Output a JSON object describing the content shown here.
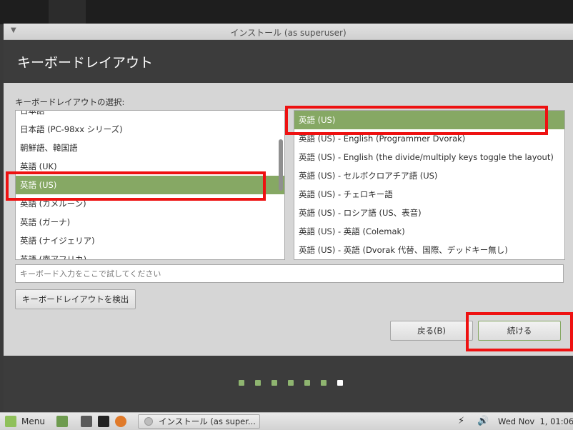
{
  "window": {
    "title": "インストール (as superuser)",
    "heading": "キーボードレイアウト"
  },
  "layout_section": {
    "label": "キーボードレイアウトの選択:",
    "left_list": [
      {
        "label": "日本語",
        "selected": false
      },
      {
        "label": "日本語 (PC-98xx シリーズ)",
        "selected": false
      },
      {
        "label": "朝鮮語、韓国語",
        "selected": false
      },
      {
        "label": "英語 (UK)",
        "selected": false
      },
      {
        "label": "英語 (US)",
        "selected": true
      },
      {
        "label": "英語 (カメルーン)",
        "selected": false
      },
      {
        "label": "英語 (ガーナ)",
        "selected": false
      },
      {
        "label": "英語 (ナイジェリア)",
        "selected": false
      },
      {
        "label": "英語 (南アフリカ)",
        "selected": false
      }
    ],
    "right_list": [
      {
        "label": "英語 (US)",
        "selected": true
      },
      {
        "label": "英語 (US) - English (Programmer Dvorak)",
        "selected": false
      },
      {
        "label": "英語 (US) - English (the divide/multiply keys toggle the layout)",
        "selected": false
      },
      {
        "label": "英語 (US) - セルボクロアチア語 (US)",
        "selected": false
      },
      {
        "label": "英語 (US) - チェロキー語",
        "selected": false
      },
      {
        "label": "英語 (US) - ロシア語 (US、表音)",
        "selected": false
      },
      {
        "label": "英語 (US) - 英語 (Colemak)",
        "selected": false
      },
      {
        "label": "英語 (US) - 英語 (Dvorak 代替、国際、デッドキー無し)",
        "selected": false
      }
    ],
    "test_placeholder": "キーボード入力をここで試してください",
    "detect_button": "キーボードレイアウトを検出"
  },
  "nav": {
    "back_button": "戻る(B)",
    "continue_button": "続ける"
  },
  "progress": {
    "total_steps": 7,
    "current_step": 7,
    "done_color": "#8fb570",
    "current_color": "#ffffff"
  },
  "taskbar": {
    "menu_label": "Menu",
    "task_label": "インストール (as super...",
    "clock": "Wed Nov  1, 01:06"
  }
}
